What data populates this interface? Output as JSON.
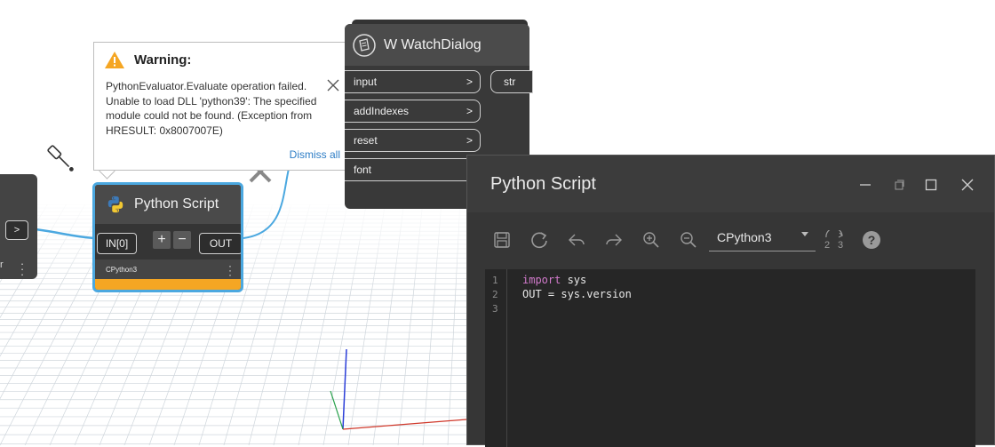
{
  "left_node": {
    "port_label": ">",
    "frag_text": "r"
  },
  "python_node": {
    "title": "Python Script",
    "input_port": "IN[0]",
    "add_label": "+",
    "remove_label": "−",
    "output_port": "OUT",
    "engine": "CPython3",
    "status": "warning",
    "colors": {
      "selected_border": "#4ba8e0",
      "warning_bar": "#f5a623"
    }
  },
  "warning": {
    "title": "Warning:",
    "message": "PythonEvaluator.Evaluate operation failed. Unable to load DLL 'python39': The specified module could not be found. (Exception from HRESULT: 0x8007007E)",
    "dismiss_all": "Dismiss all",
    "icon": "warning-triangle-icon",
    "colors": {
      "icon": "#f5a623",
      "link": "#2d7dc6"
    }
  },
  "watch_node": {
    "title": "W WatchDialog",
    "inputs": [
      {
        "label": "input",
        "arrow": ">"
      },
      {
        "label": "addIndexes",
        "arrow": ">"
      },
      {
        "label": "reset",
        "arrow": ">"
      },
      {
        "label": "font",
        "arrow": ""
      }
    ],
    "output": "str"
  },
  "editor": {
    "title": "Python Script",
    "window_buttons": [
      "minimize-icon",
      "restore-icon",
      "maximize-icon",
      "close-icon"
    ],
    "toolbar": [
      "save-icon",
      "run-icon",
      "undo-icon",
      "redo-icon",
      "zoom-in-icon",
      "zoom-out-icon"
    ],
    "engine_value": "CPython3",
    "migration_icon": "python2to3-icon",
    "help_icon": "help-icon",
    "code": {
      "line_numbers": [
        "1",
        "2",
        "3"
      ],
      "line1_keyword": "import",
      "line1_rest": " sys",
      "line2": "OUT = sys.version",
      "line3": ""
    }
  }
}
